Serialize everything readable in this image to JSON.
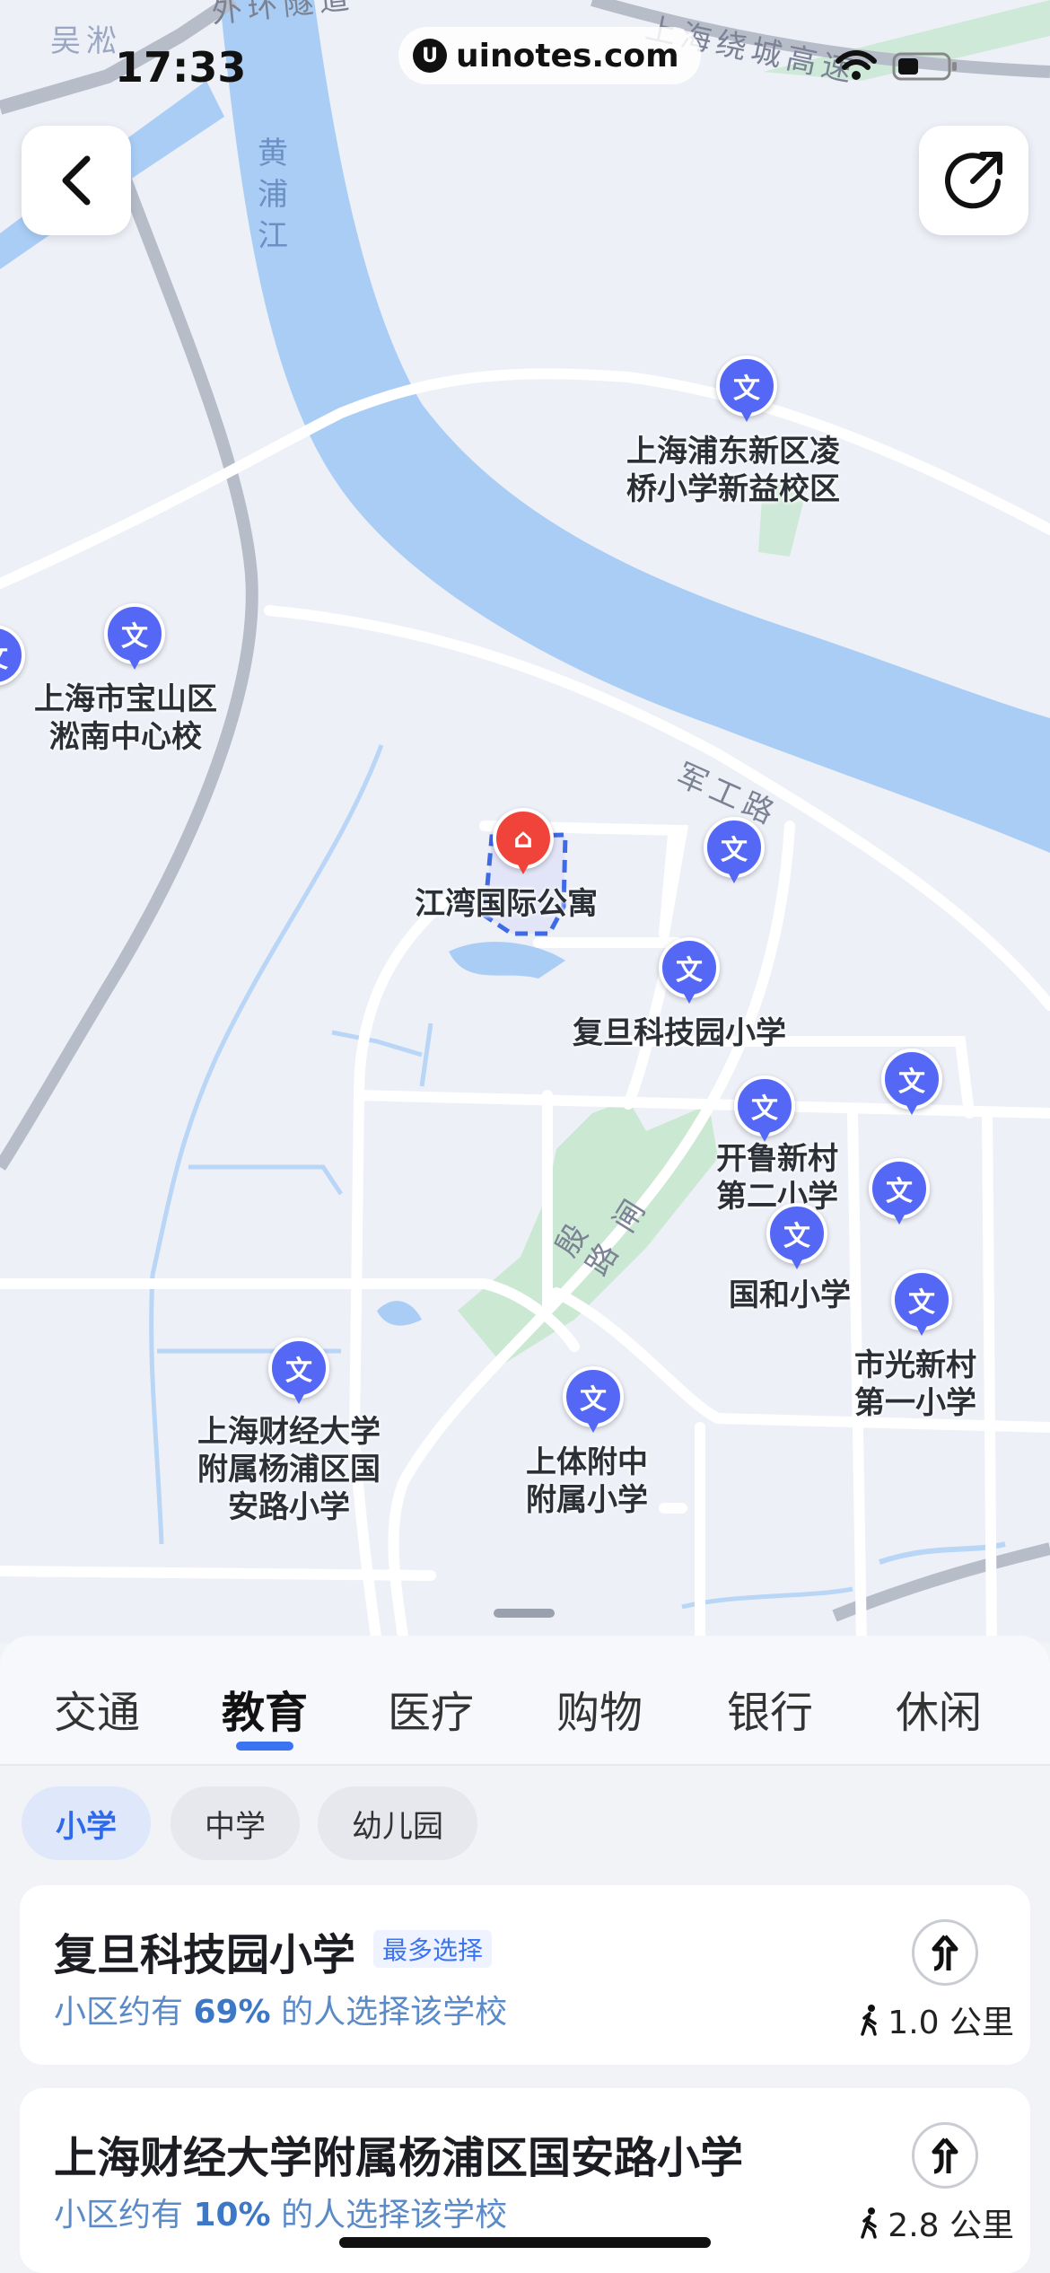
{
  "status_bar": {
    "time": "17:33",
    "url": "uinotes.com",
    "url_logo": "U"
  },
  "map": {
    "center_place": "江湾国际公寓",
    "river_label": "黄\n浦\n江",
    "district_label": "吴淞",
    "road_labels": {
      "top_left": "外环隧道",
      "top_right": "上海绕城高速",
      "jungong": "军工路",
      "yindu": "殷\n路",
      "nan": "闸"
    },
    "pin_glyph": "文",
    "home_glyph": "⌂",
    "schools": [
      "上海浦东新区凌\n桥小学新益校区",
      "上海市宝山区\n淞南中心校",
      "复旦科技园小学",
      "开鲁新村\n第二小学",
      "国和小学",
      "市光新村\n第一小学",
      "上海财经大学\n附属杨浦区国\n安路小学",
      "上体附中\n附属小学"
    ]
  },
  "buttons": {
    "back_icon": "back-chevron",
    "share_icon": "share-arrow"
  },
  "tabs": [
    "交通",
    "教育",
    "医疗",
    "购物",
    "银行",
    "休闲"
  ],
  "active_tab": "教育",
  "chips": [
    "小学",
    "中学",
    "幼儿园"
  ],
  "active_chip": "小学",
  "results": [
    {
      "name": "复旦科技园小学",
      "badge": "最多选择",
      "desc_prefix": "小区约有 ",
      "percent": "69%",
      "desc_suffix": " 的人选择该学校",
      "distance": "1.0 公里"
    },
    {
      "name": "上海财经大学附属杨浦区国安路小学",
      "badge": "",
      "desc_prefix": "小区约有 ",
      "percent": "10%",
      "desc_suffix": " 的人选择该学校",
      "distance": "2.8 公里"
    }
  ],
  "colors": {
    "pin_blue": "#5468f5",
    "pin_red": "#f0443b",
    "river": "#a9cdf5",
    "accent": "#3b73f2"
  }
}
